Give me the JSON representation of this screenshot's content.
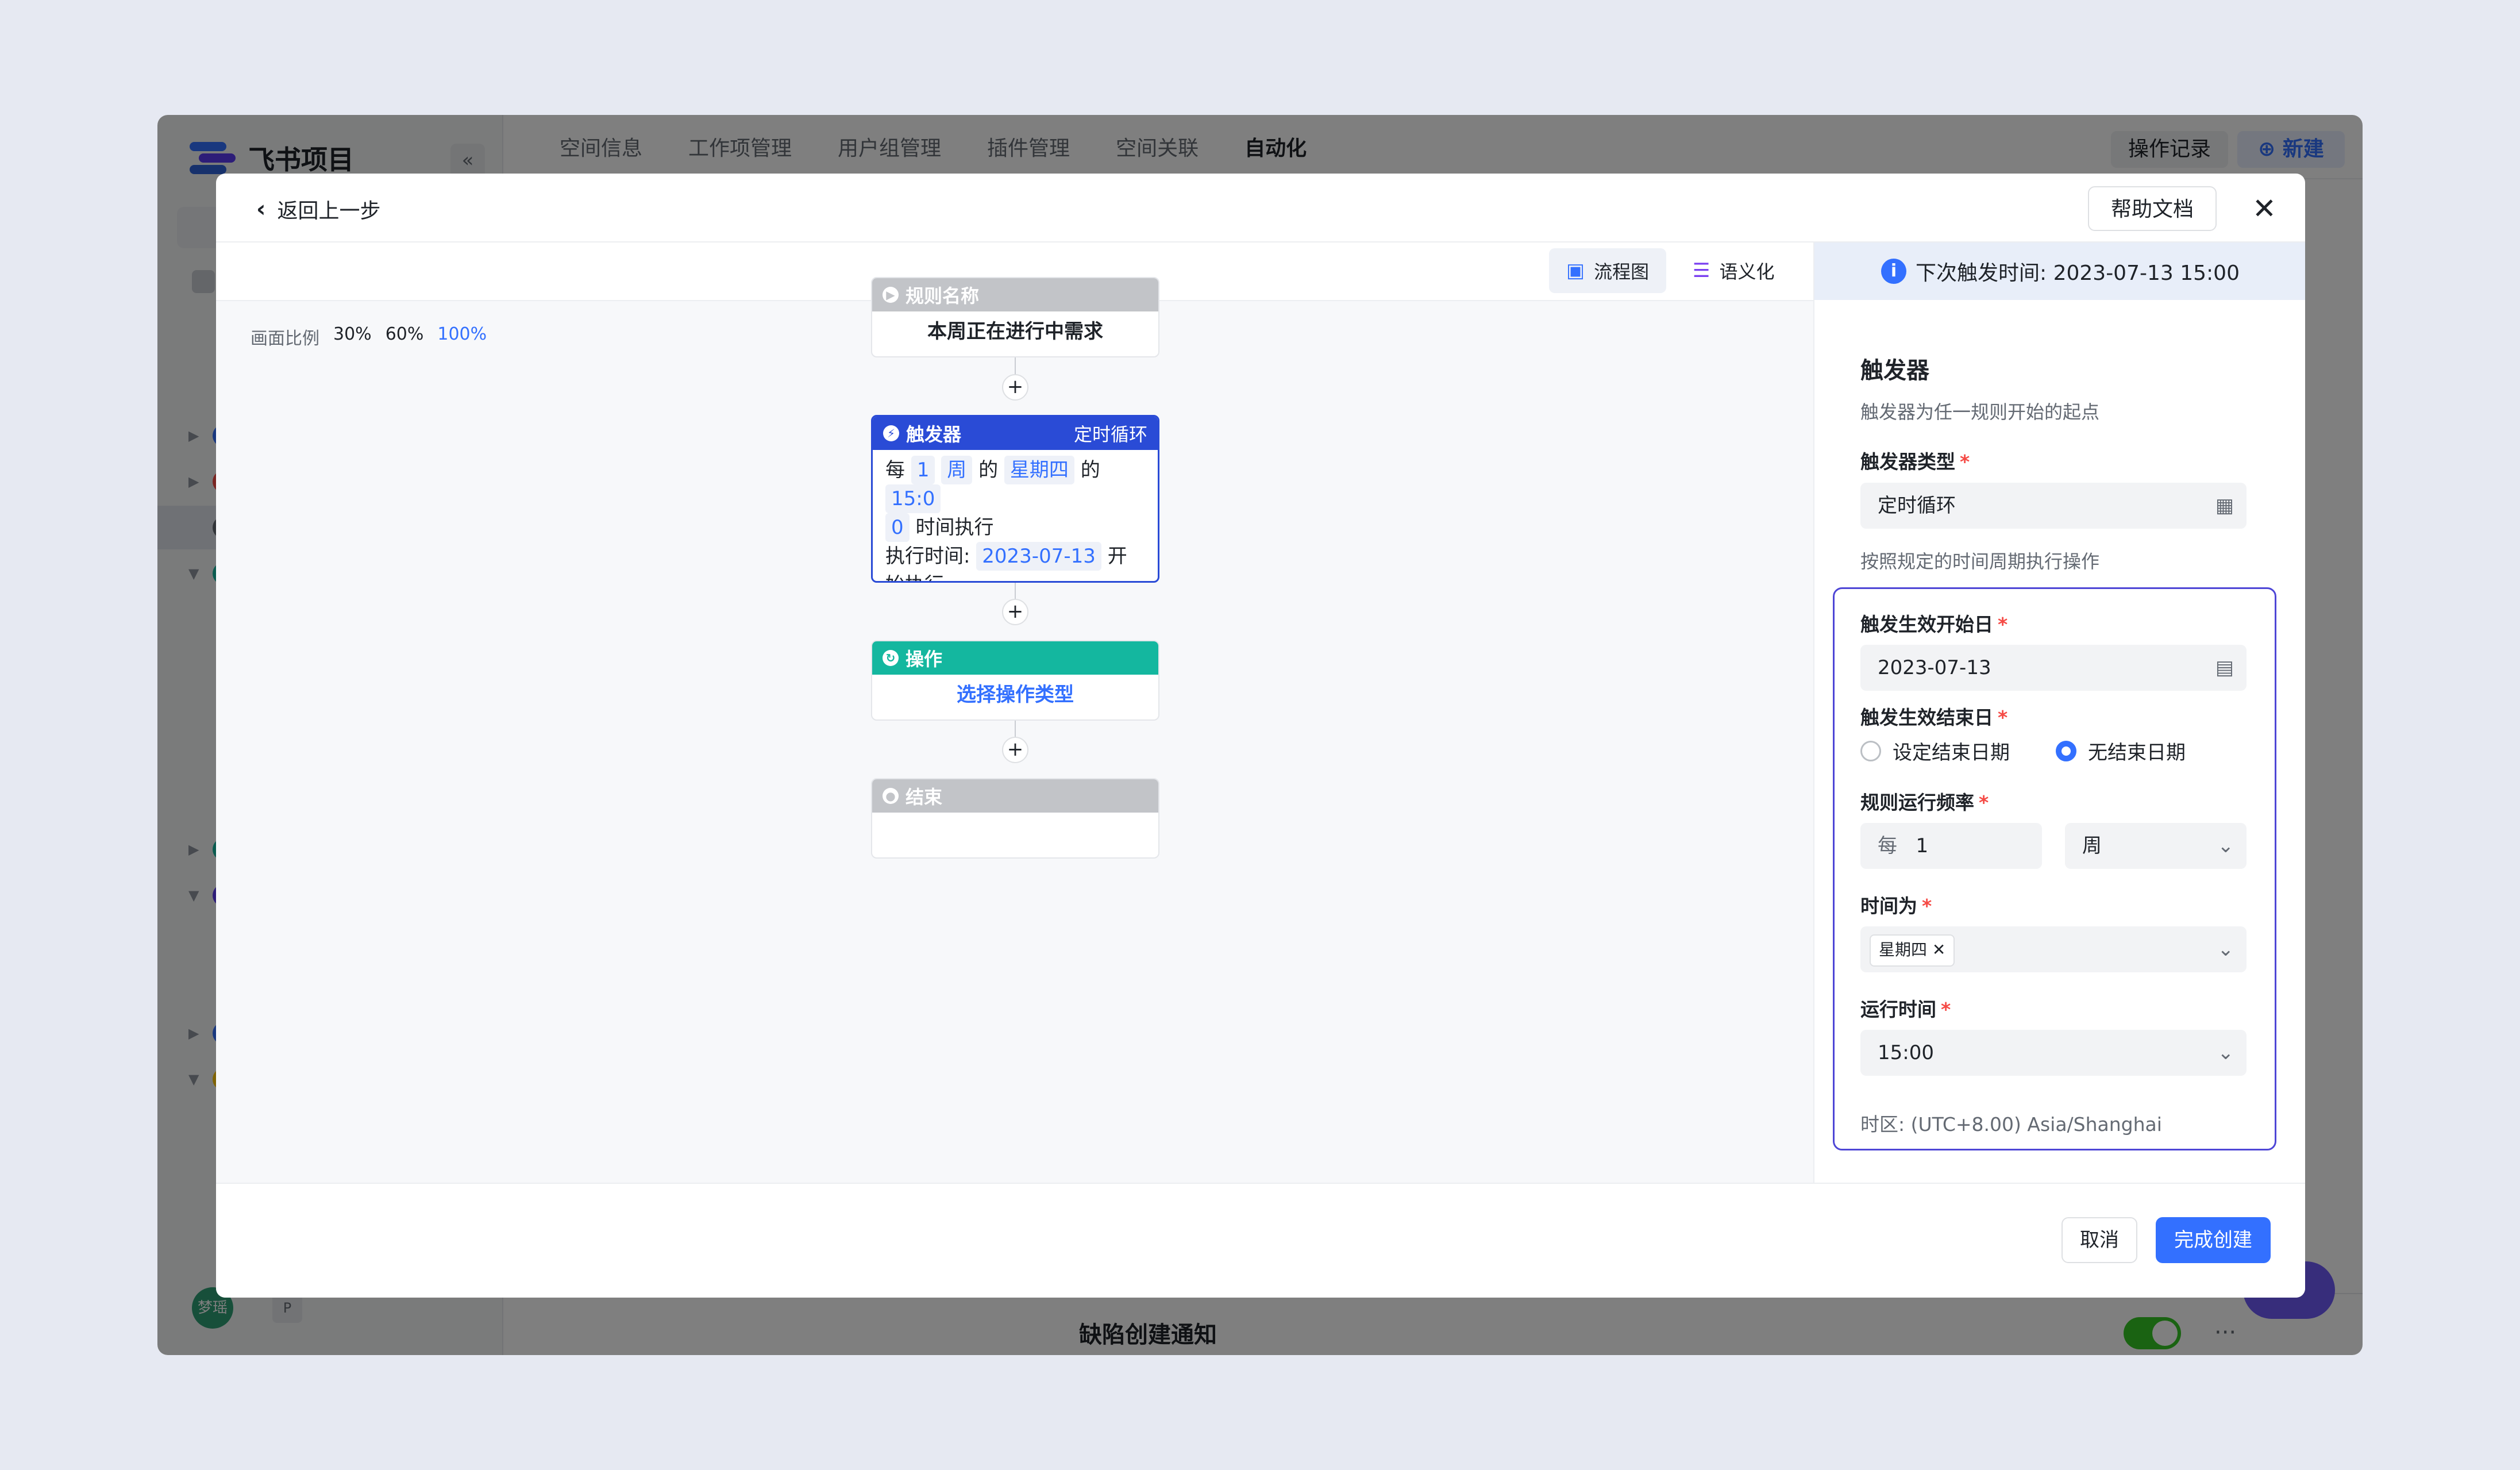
{
  "app": {
    "title": "飞书项目",
    "collapse_glyph": "«",
    "tabs": [
      {
        "label": "空间信息"
      },
      {
        "label": "工作项管理"
      },
      {
        "label": "用户组管理"
      },
      {
        "label": "插件管理"
      },
      {
        "label": "空间关联"
      },
      {
        "label": "自动化",
        "active": true
      }
    ],
    "operation_record": "操作记录",
    "new_button": "新建",
    "avatar_text": "梦瑶",
    "p_badge": "P",
    "bottom_item": "缺陷创建通知"
  },
  "modal": {
    "back_label": "返回上一步",
    "help_label": "帮助文档",
    "close_glyph": "✕"
  },
  "canvas": {
    "view_tabs": [
      {
        "label": "流程图",
        "active": true
      },
      {
        "label": "语义化",
        "active": false
      }
    ],
    "scale": {
      "label": "画面比例",
      "options": [
        "30%",
        "60%",
        "100%"
      ],
      "active": "100%"
    },
    "rule_node": {
      "header": "规则名称",
      "title": "本周正在进行中需求"
    },
    "trigger_node": {
      "header": "触发器",
      "tag": "定时循环",
      "line1_every": "每",
      "line1_num": "1",
      "line1_unit": "周",
      "line1_of": "的",
      "line1_day": "星期四",
      "line1_of2": "的",
      "line1_time_a": "15:0",
      "line2_time_b": "0",
      "line2_text": "时间执行",
      "line3_label": "执行时间:",
      "line3_date": "2023-07-13",
      "line3_start": "开",
      "line4_text": "始执行"
    },
    "action_node": {
      "header": "操作",
      "body": "选择操作类型"
    },
    "end_node": {
      "header": "结束"
    },
    "plus_glyph": "+"
  },
  "panel": {
    "next_trigger": "下次触发时间: 2023-07-13 15:00",
    "title": "触发器",
    "desc": "触发器为任一规则开始的起点",
    "trigger_type_label": "触发器类型",
    "trigger_type_value": "定时循环",
    "trigger_type_hint": "按照规定的时间周期执行操作",
    "start_date_label": "触发生效开始日",
    "start_date_value": "2023-07-13",
    "end_date_label": "触发生效结束日",
    "end_date_options": [
      {
        "label": "设定结束日期",
        "selected": false
      },
      {
        "label": "无结束日期",
        "selected": true
      }
    ],
    "frequency_label": "规则运行频率",
    "frequency_prefix": "每",
    "frequency_value": "1",
    "frequency_unit": "周",
    "time_label": "时间为",
    "time_chip": "星期四",
    "run_time_label": "运行时间",
    "run_time_value": "15:00",
    "timezone": "时区: (UTC+8.00) Asia/Shanghai",
    "required_mark": "*"
  },
  "footer": {
    "cancel": "取消",
    "create": "完成创建"
  },
  "colors": {
    "primary": "#3370ff",
    "trigger_header": "#2a4bd6",
    "action_header": "#14b79f",
    "muted_header": "#c2c4c8",
    "highlight_border": "#4e46d6"
  }
}
